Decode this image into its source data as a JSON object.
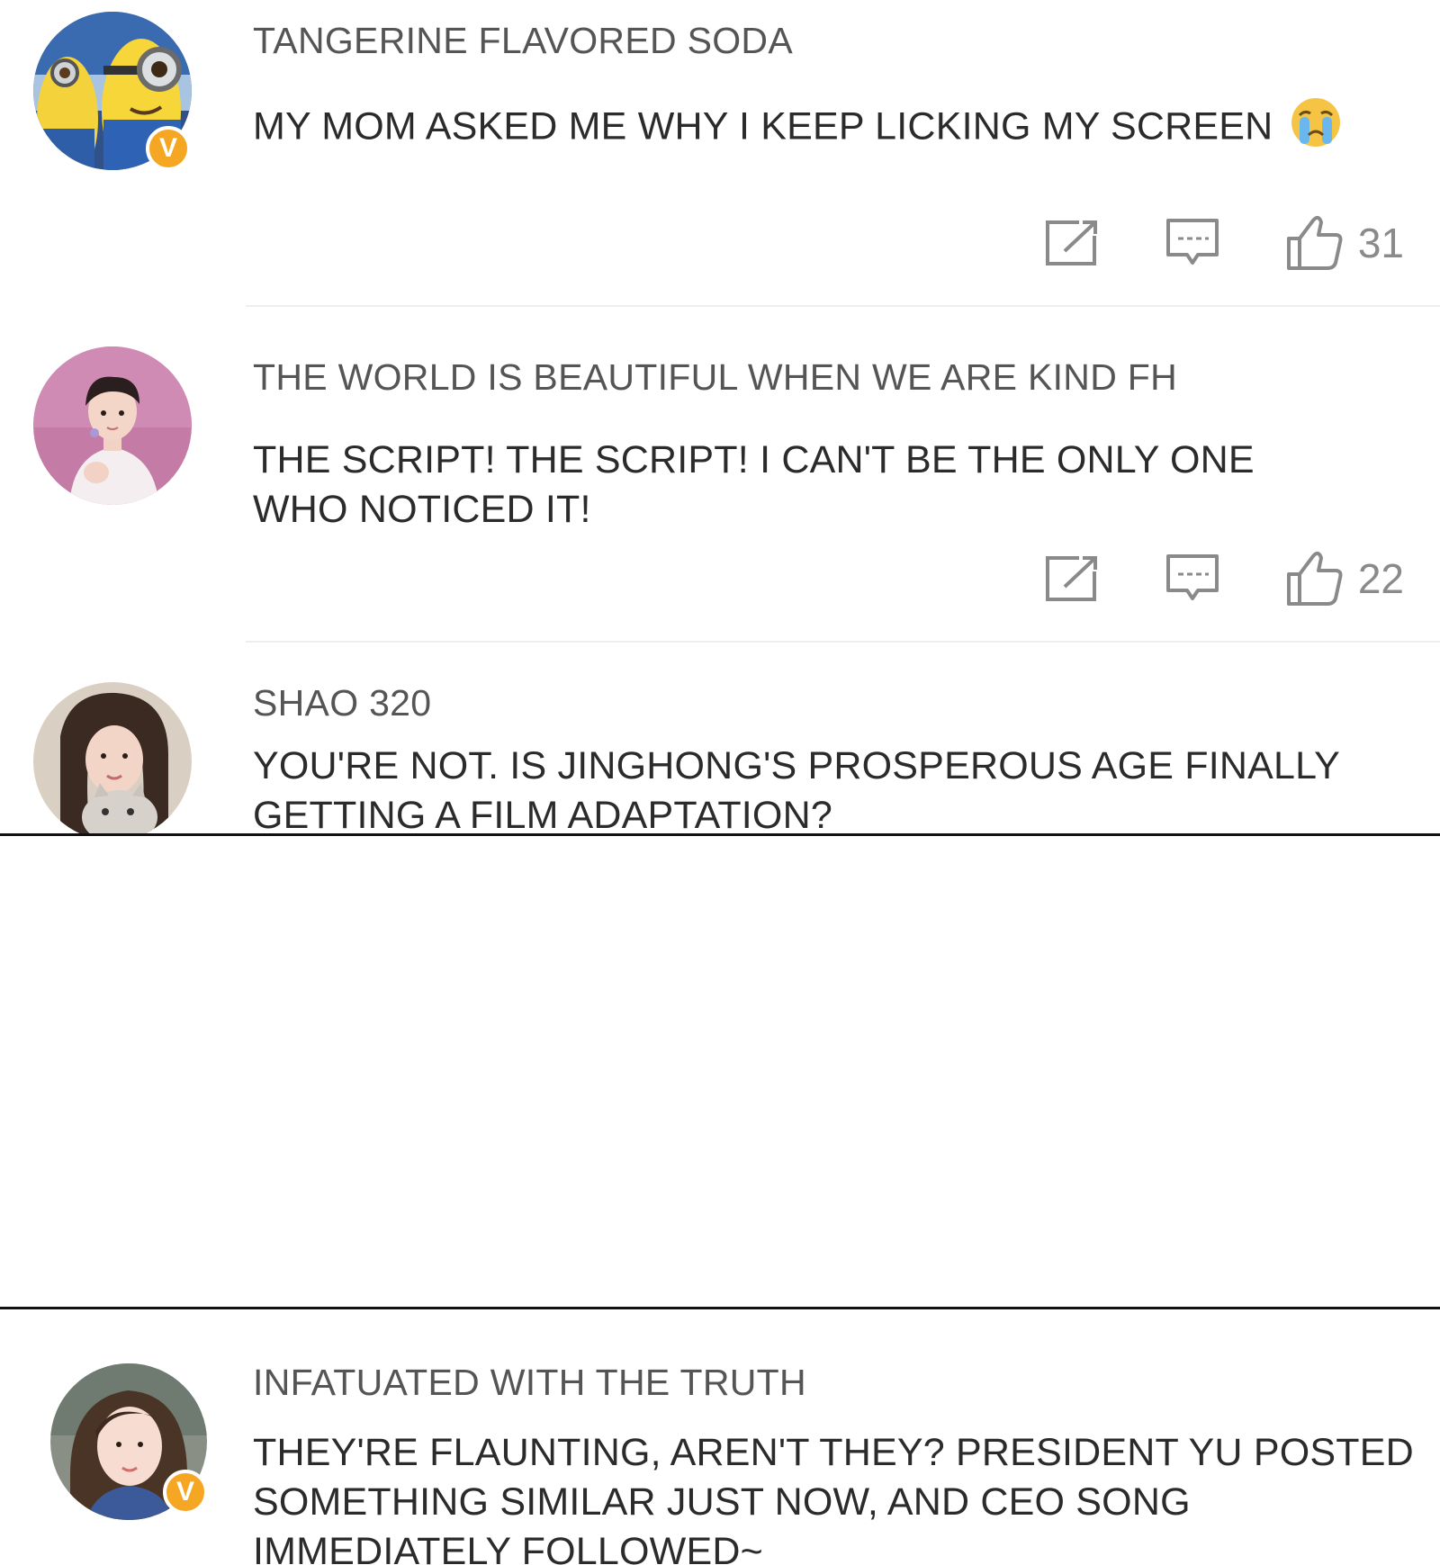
{
  "comments": [
    {
      "username": "TANGERINE FLAVORED SODA",
      "text": "MY MOM ASKED ME WHY I KEEP LICKING MY SCREEN",
      "emoji": "crying-face-emoji",
      "verified": true,
      "likes": "31"
    },
    {
      "username": "THE WORLD IS BEAUTIFUL WHEN WE ARE KIND FH",
      "text": "THE SCRIPT! THE SCRIPT! I CAN'T BE THE ONLY ONE WHO NOTICED IT!",
      "verified": false,
      "likes": "22"
    },
    {
      "username": "SHAO 320",
      "text": "YOU'RE NOT. IS JINGHONG'S PROSPEROUS AGE FINALLY GETTING A FILM ADAPTATION?",
      "verified": false
    },
    {
      "username": "INFATUATED WITH THE TRUTH",
      "text": "THEY'RE FLAUNTING, AREN'T THEY? PRESIDENT YU POSTED SOMETHING SIMILAR JUST NOW, AND CEO SONG IMMEDIATELY FOLLOWED~",
      "verified": true
    }
  ],
  "icons": {
    "repost": "repost-icon",
    "comment": "comment-icon",
    "like": "thumbs-up-icon",
    "verified": "verified-badge-icon",
    "verified_glyph": "V"
  },
  "colors": {
    "badge": "#f5a623",
    "text": "#2b2b2b",
    "username": "#555555",
    "count": "#8a8a8a",
    "icon": "#8a8a8a"
  }
}
